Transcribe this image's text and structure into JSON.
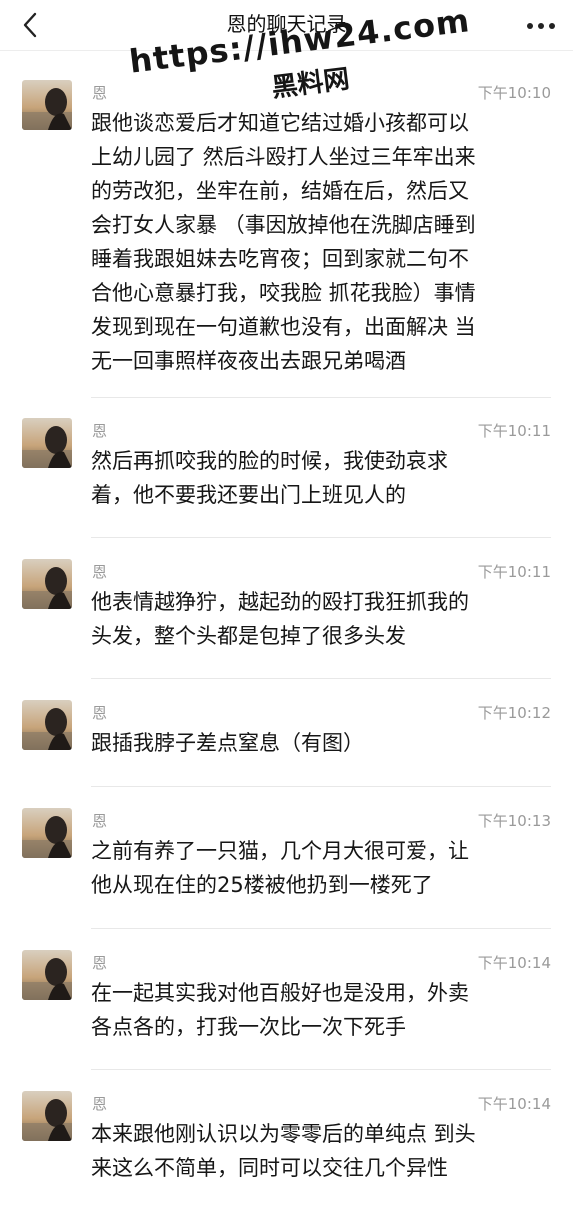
{
  "header": {
    "title": "恩的聊天记录"
  },
  "watermark": {
    "url": "https://ihw24.com",
    "subtitle": "黑料网"
  },
  "messages": [
    {
      "sender": "恩",
      "time": "下午10:10",
      "text": "跟他谈恋爱后才知道它结过婚小孩都可以\n上幼儿园了 然后斗殴打人坐过三年牢出来\n的劳改犯，坐牢在前，结婚在后，然后又\n会打女人家暴 （事因放掉他在洗脚店睡到\n睡着我跟姐妹去吃宵夜；回到家就二句不\n合他心意暴打我，咬我脸 抓花我脸）事情\n发现到现在一句道歉也没有，出面解决 当\n无一回事照样夜夜出去跟兄弟喝酒"
    },
    {
      "sender": "恩",
      "time": "下午10:11",
      "text": "然后再抓咬我的脸的时候，我使劲哀求\n着，他不要我还要出门上班见人的"
    },
    {
      "sender": "恩",
      "time": "下午10:11",
      "text": "他表情越狰狞，越起劲的殴打我狂抓我的\n头发，整个头都是包掉了很多头发"
    },
    {
      "sender": "恩",
      "time": "下午10:12",
      "text": "跟插我脖子差点窒息（有图）"
    },
    {
      "sender": "恩",
      "time": "下午10:13",
      "text": "之前有养了一只猫，几个月大很可爱，让\n他从现在住的25楼被他扔到一楼死了"
    },
    {
      "sender": "恩",
      "time": "下午10:14",
      "text": "在一起其实我对他百般好也是没用，外卖\n各点各的，打我一次比一次下死手"
    },
    {
      "sender": "恩",
      "time": "下午10:14",
      "text": "本来跟他刚认识以为零零后的单纯点 到头\n来这么不简单，同时可以交往几个异性"
    }
  ],
  "icons": {
    "back": "chevron-left-icon",
    "more": "more-horizontal-icon",
    "avatar": "avatar-photo"
  },
  "colors": {
    "meta_text": "#9a9a9a",
    "divider": "#e8e8e8",
    "background": "#ffffff"
  }
}
